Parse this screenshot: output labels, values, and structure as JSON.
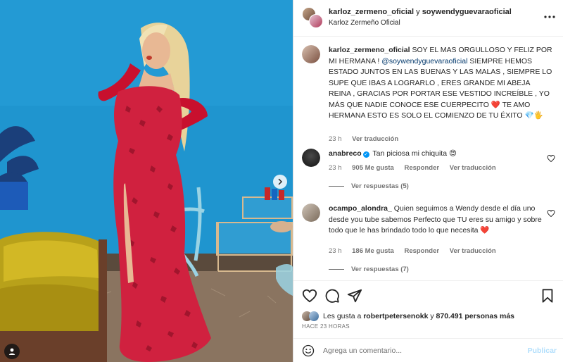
{
  "colors": {
    "wall": "#1f95cf",
    "dress": "#d0213f",
    "link": "#00376b",
    "muted": "#737373",
    "post_button": "#b2dffc",
    "verified": "#0095f6",
    "heart": "#e11d48"
  },
  "photo": {
    "next_icon": "chevron-right-icon",
    "tag_icon": "user-tag-icon"
  },
  "header": {
    "user1": "karloz_zermeno_oficial",
    "joiner": " y ",
    "user2": "soywendyguevaraoficial",
    "subtitle": "Karloz Zermeño Oficial",
    "more_icon": "more-icon"
  },
  "caption": {
    "user": "karloz_zermeno_oficial",
    "text_a": " SOY EL MAS ORGULLOSO Y FELIZ POR MI HERMANA ! ",
    "mention": "@soywendyguevaraoficial",
    "text_b": " SIEMPRE HEMOS ESTADO JUNTOS EN LAS BUENAS Y LAS MALAS , SIEMPRE LO SUPE QUE IBAS A LOGRARLO , ERES GRANDE MI ABEJA REINA , GRACIAS POR PORTAR ESE VESTIDO INCREÍBLE , YO MÁS QUE NADIE CONOCE ESE CUERPECITO ❤️ TE AMO HERMANA ESTO ES SOLO EL COMIENZO DE TU ÉXITO 💎🖐",
    "time": "23 h",
    "translate": "Ver traducción"
  },
  "comments": [
    {
      "user": "anabreco",
      "verified": true,
      "text": " Tan piciosa mi chiquita 😍",
      "time": "23 h",
      "likes": "905 Me gusta",
      "reply": "Responder",
      "translate": "Ver traducción",
      "replies": "Ver respuestas (5)"
    },
    {
      "user": "ocampo_alondra_",
      "verified": false,
      "text": " Quien seguimos a Wendy desde el día uno desde you tube sabemos Perfecto que TU eres su amigo y sobre todo que le has brindado todo lo que necesita ❤️",
      "time": "23 h",
      "likes": "186 Me gusta",
      "reply": "Responder",
      "translate": "Ver traducción",
      "replies": "Ver respuestas (7)"
    }
  ],
  "actions": {
    "like_icon": "heart-icon",
    "comment_icon": "comment-icon",
    "share_icon": "share-icon",
    "save_icon": "bookmark-icon"
  },
  "likes": {
    "prefix": "Les gusta a ",
    "user": "robertpetersenokk",
    "middle": " y ",
    "count": "870.491 personas más"
  },
  "posted_ago": "HACE 23 HORAS",
  "composer": {
    "placeholder": "Agrega un comentario...",
    "post_label": "Publicar",
    "emoji_icon": "emoji-icon"
  }
}
